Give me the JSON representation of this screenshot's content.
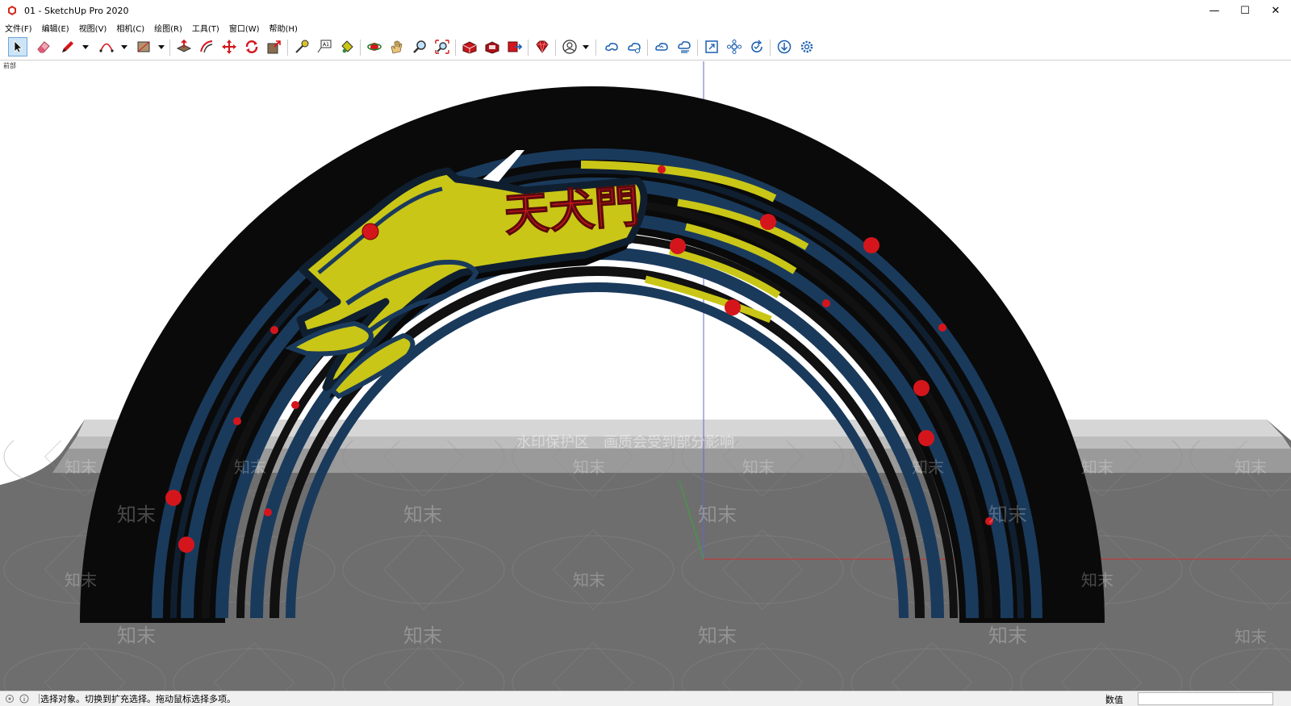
{
  "window": {
    "title": "01 - SketchUp Pro 2020",
    "minimize_glyph": "—",
    "maximize_glyph": "☐",
    "close_glyph": "✕"
  },
  "menu": [
    "文件(F)",
    "编辑(E)",
    "视图(V)",
    "相机(C)",
    "绘图(R)",
    "工具(T)",
    "窗口(W)",
    "帮助(H)"
  ],
  "toolbar_icons": [
    "select-icon",
    "eraser-icon",
    "pencil-icon",
    "arc-icon",
    "rectangle-icon",
    "push-pull-icon",
    "offset-icon",
    "move-icon",
    "rotate-icon",
    "scale-icon",
    "tape-measure-icon",
    "text-icon",
    "paint-bucket-icon",
    "orbit-icon",
    "pan-icon",
    "zoom-icon",
    "zoom-extents-icon",
    "warehouse-icon",
    "extension-warehouse-icon",
    "layout-icon",
    "ruby-icon",
    "account-icon",
    "cloud-share-icon",
    "cloud-upload-icon",
    "cloud-sync-icon",
    "cloud-download-icon",
    "frame-icon",
    "components-icon",
    "refresh-icon",
    "download-icon",
    "settings-icon"
  ],
  "viewport": {
    "scene_label": "前部",
    "sign_text": "天犬門",
    "watermark_main": "水印保护区　画质会受到部分影响",
    "watermark_tile": "知末"
  },
  "statusbar": {
    "text": "选择对象。切换到扩充选择。拖动鼠标选择多项。",
    "measure_label": "数值",
    "measure_value": ""
  },
  "colors": {
    "arch_blue": "#1a3a5c",
    "arch_black": "#111111",
    "dog_yellow": "#c9c617",
    "dot_red": "#d4161c",
    "text_red": "#c8161d",
    "ground": "#6e6e6e",
    "axis_blue": "#6666cc",
    "axis_red": "#cc3333",
    "axis_green": "#33aa33"
  }
}
